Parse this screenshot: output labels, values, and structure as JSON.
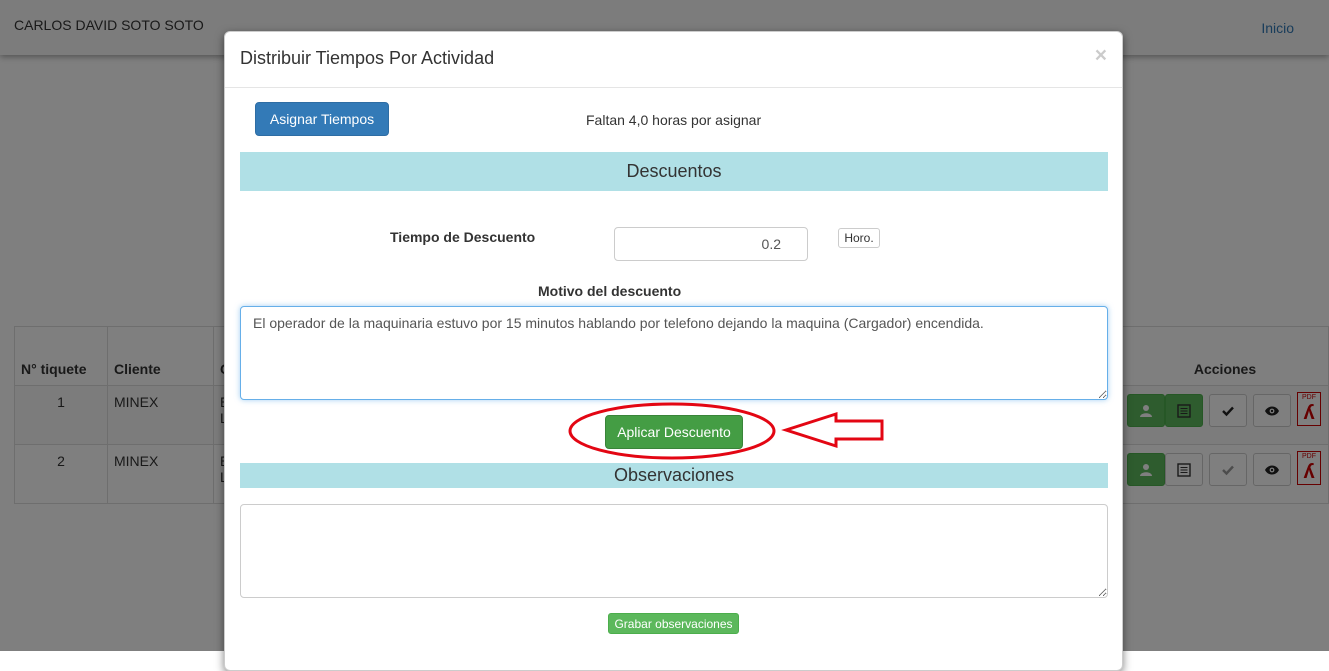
{
  "topbar": {
    "user_name": "CARLOS DAVID SOTO SOTO",
    "nav_home": "Inicio"
  },
  "table": {
    "headers": [
      "N° tiquete",
      "Cliente",
      "C",
      "Acciones"
    ],
    "rows": [
      {
        "ticket": "1",
        "client": "MINEX",
        "col3_line1": "E",
        "col3_line2": "L"
      },
      {
        "ticket": "2",
        "client": "MINEX",
        "col3_line1": "E",
        "col3_line2": "L"
      }
    ],
    "action_icons": [
      "user-icon",
      "list-icon",
      "check-icon",
      "eye-icon",
      "pdf-icon"
    ],
    "pdf_label": "PDF"
  },
  "modal": {
    "title": "Distribuir Tiempos Por Actividad",
    "close_label": "×",
    "assign_button": "Asignar Tiempos",
    "remaining_text": "Faltan 4,0 horas por asignar",
    "discounts_header": "Descuentos",
    "discount_time_label": "Tiempo de Descuento",
    "discount_time_value": "0.2",
    "unit_label": "Horo.",
    "discount_reason_label": "Motivo del descuento",
    "discount_reason_value": "El operador de la maquinaria estuvo por 15 minutos hablando por telefono dejando la maquina (Cargador) encendida.",
    "apply_button": "Aplicar Descuento",
    "observations_header": "Observaciones",
    "observations_value": "",
    "save_observations_button": "Grabar observaciones"
  },
  "colors": {
    "primary": "#337ab7",
    "success": "#449d44",
    "section_bar": "#b0e0e6",
    "annotation": "#e30613"
  }
}
